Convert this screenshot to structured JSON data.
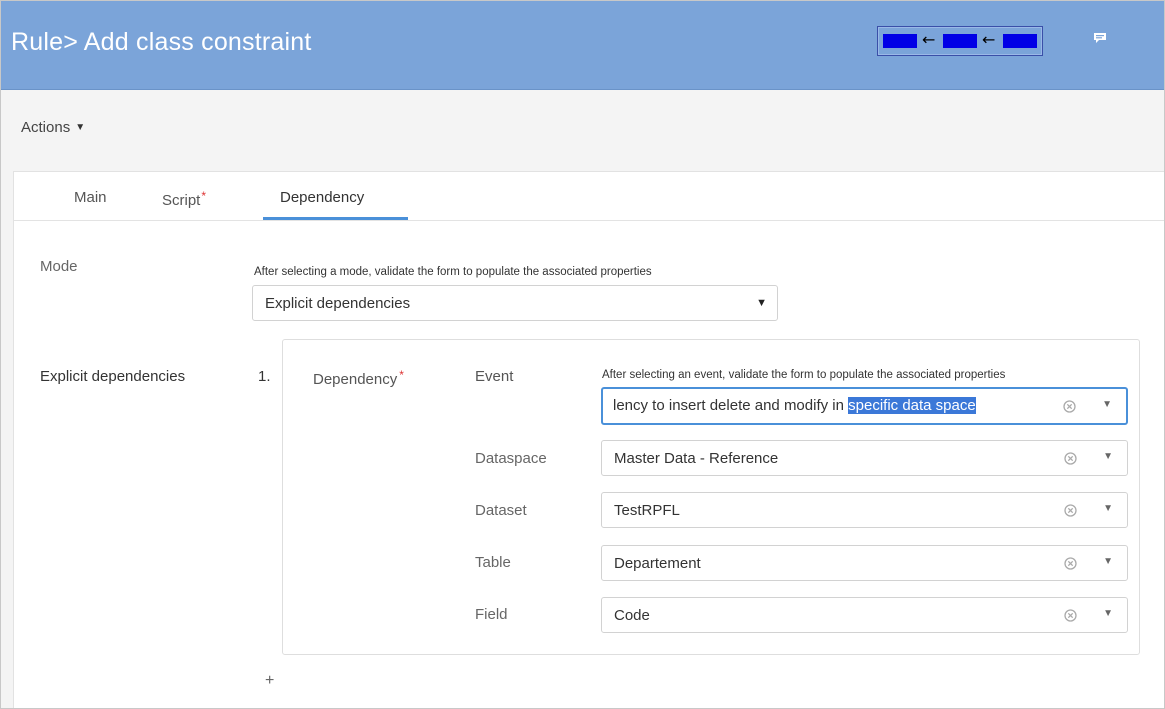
{
  "header": {
    "title": "Rule> Add class constraint",
    "history_arrows": [
      "←",
      "←"
    ]
  },
  "actions": {
    "label": "Actions",
    "caret": "▼"
  },
  "tabs": [
    {
      "label": "Main",
      "required": false
    },
    {
      "label": "Script",
      "required": true,
      "marker": "*"
    },
    {
      "label": "Dependency",
      "required": false,
      "active": true
    }
  ],
  "mode": {
    "label": "Mode",
    "help": "After selecting a mode, validate the form to populate the associated properties",
    "value": "Explicit dependencies",
    "caret": "▼"
  },
  "explicit": {
    "label": "Explicit dependencies",
    "index": "1.",
    "dependency_label": "Dependency",
    "required_marker": "*",
    "event": {
      "label": "Event",
      "help": "After selecting an event, validate the form to populate the associated properties",
      "value_plain": "lency to insert delete and modify in ",
      "value_selected": "specific data space"
    },
    "fields": [
      {
        "label": "Dataspace",
        "value": "Master Data - Reference"
      },
      {
        "label": "Dataset",
        "value": "TestRPFL"
      },
      {
        "label": "Table",
        "value": "Departement"
      },
      {
        "label": "Field",
        "value": "Code"
      }
    ],
    "add": "+"
  },
  "icons": {
    "chat": "chat-bubble-icon",
    "clear": "clear-circle-icon",
    "dropdown": "chevron-down-icon"
  },
  "colors": {
    "header_bg": "#7ba4d9",
    "accent": "#4a90d9",
    "required": "#dd3333",
    "selection": "#3b78d8"
  }
}
